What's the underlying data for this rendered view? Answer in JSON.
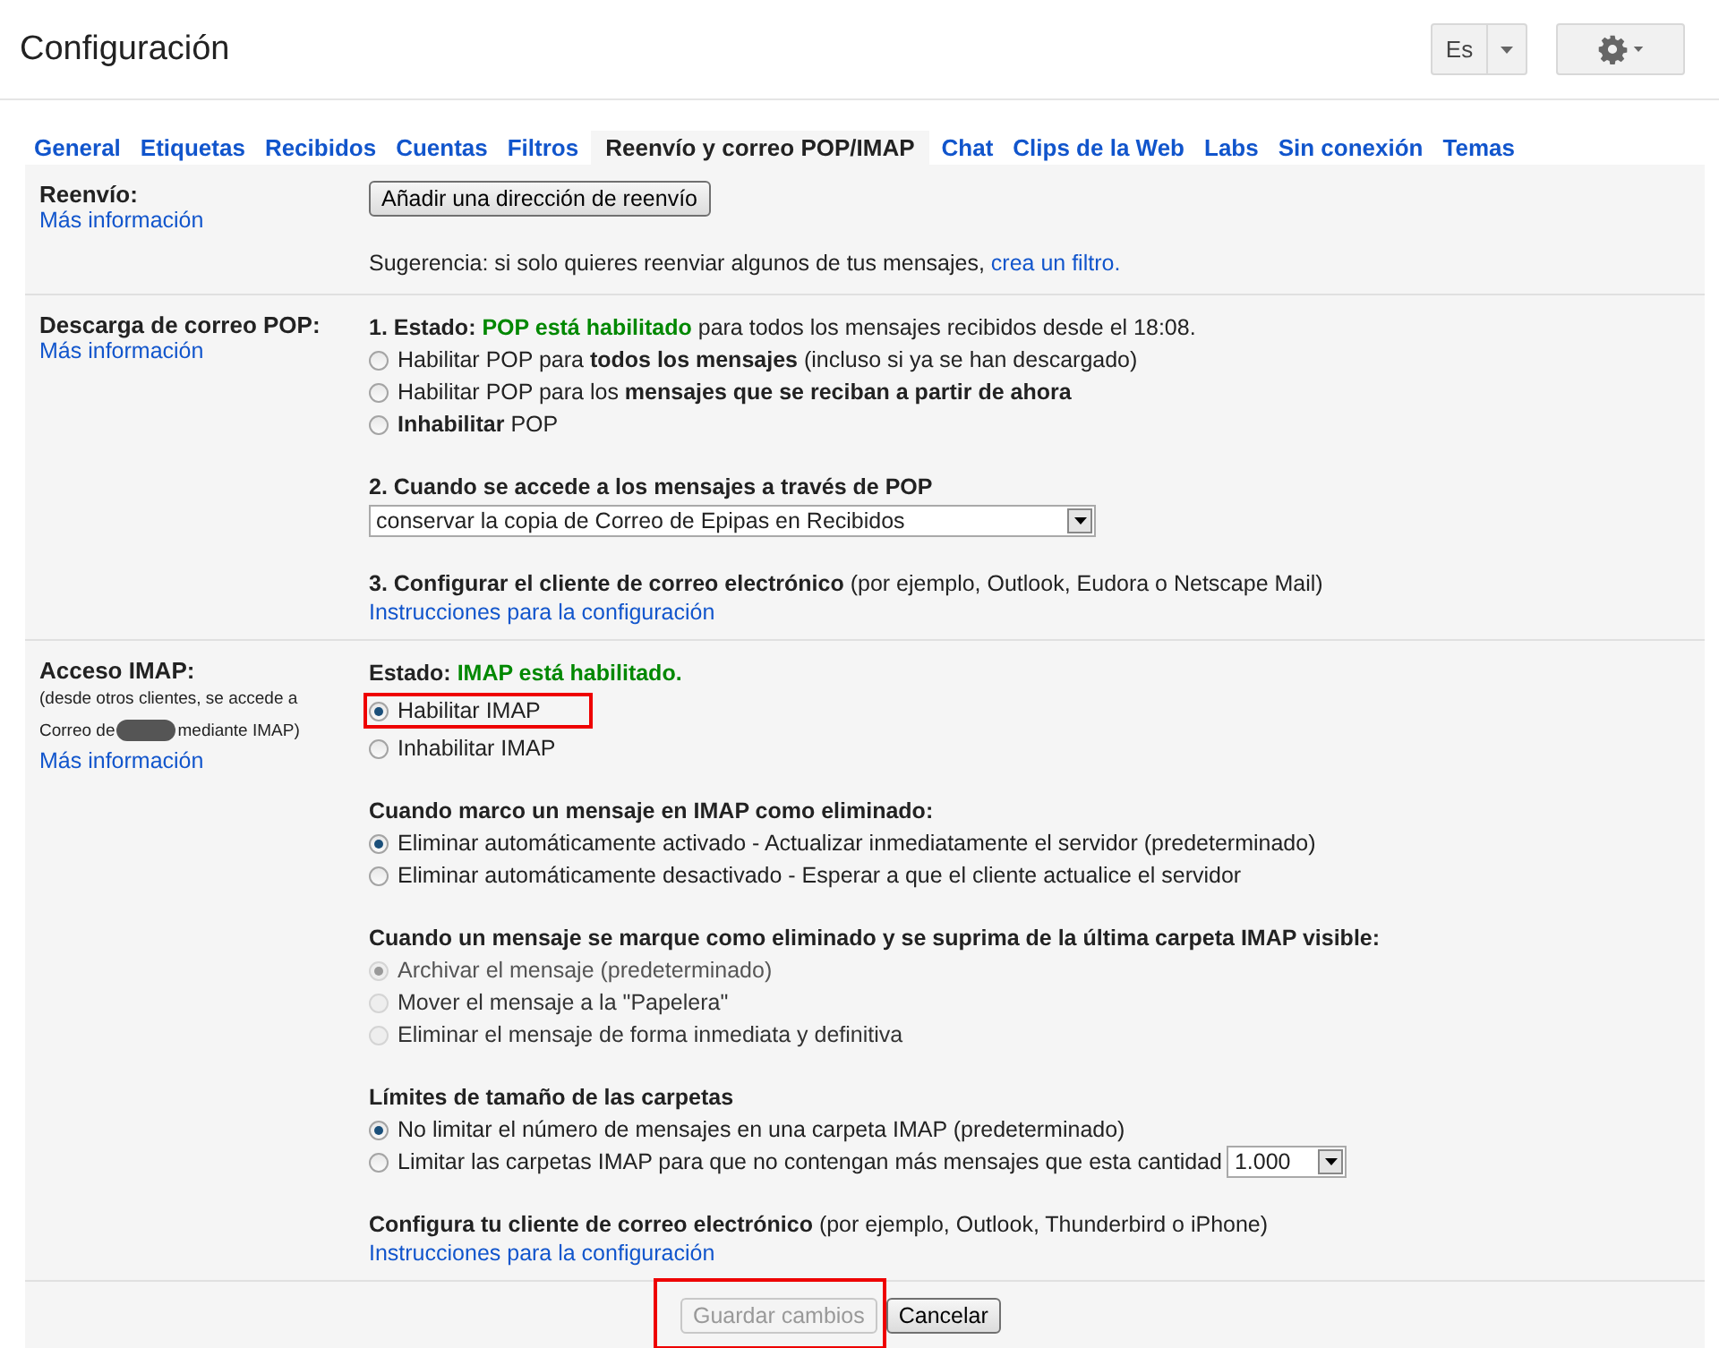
{
  "header": {
    "title": "Configuración",
    "language": "Es"
  },
  "tabs": [
    {
      "label": "General",
      "selected": false
    },
    {
      "label": "Etiquetas",
      "selected": false
    },
    {
      "label": "Recibidos",
      "selected": false
    },
    {
      "label": "Cuentas",
      "selected": false
    },
    {
      "label": "Filtros",
      "selected": false
    },
    {
      "label": "Reenvío y correo POP/IMAP",
      "selected": true
    },
    {
      "label": "Chat",
      "selected": false
    },
    {
      "label": "Clips de la Web",
      "selected": false
    },
    {
      "label": "Labs",
      "selected": false
    },
    {
      "label": "Sin conexión",
      "selected": false
    },
    {
      "label": "Temas",
      "selected": false
    }
  ],
  "sections": [
    {
      "label": "Reenvío:",
      "link": "Más información",
      "groups": [
        [
          {
            "kind": "button",
            "label": "Añadir una dirección de reenvío",
            "disabled": false,
            "highlighted": false
          }
        ],
        [
          {
            "kind": "hint",
            "text": "Sugerencia: si solo quieres reenviar algunos de tus mensajes,",
            "link": "crea un filtro."
          }
        ]
      ]
    },
    {
      "label": "Descarga de correo POP:",
      "link": "Más información",
      "groups": [
        [
          {
            "kind": "status",
            "head": "1. Estado:",
            "value": "POP está habilitado",
            "rest": "para todos los mensajes recibidos desde el 18:08."
          },
          {
            "kind": "radio",
            "label": "Habilitar POP para **todos los mensajes** (incluso si ya se han descargado)",
            "selected": false,
            "disabled": false,
            "highlighted": false
          },
          {
            "kind": "radio",
            "label": "Habilitar POP para los **mensajes que se reciban a partir de ahora**",
            "selected": false,
            "disabled": false,
            "highlighted": false
          },
          {
            "kind": "radio",
            "label": "**Inhabilitar** POP",
            "selected": false,
            "disabled": false,
            "highlighted": false
          }
        ],
        [
          {
            "kind": "heading",
            "text": "2. Cuando se accede a los mensajes a través de POP"
          },
          {
            "kind": "select",
            "value": "conservar la copia de Correo de Epipas en Recibidos"
          }
        ],
        [
          {
            "kind": "heading",
            "text": "3. Configurar el cliente de correo electrónico",
            "rest": "(por ejemplo, Outlook, Eudora o Netscape Mail)"
          },
          {
            "kind": "link",
            "text": "Instrucciones para la configuración"
          }
        ]
      ]
    },
    {
      "label": "Acceso IMAP:",
      "note": {
        "line": "(desde otros clientes, se accede a",
        "before": "Correo de",
        "after": "mediante IMAP)",
        "redacted": true
      },
      "link": "Más información",
      "groups": [
        [
          {
            "kind": "status",
            "head": "Estado:",
            "value": "IMAP está habilitado."
          },
          {
            "kind": "radio",
            "label": "Habilitar IMAP",
            "selected": true,
            "disabled": false,
            "highlighted": true
          },
          {
            "kind": "radio",
            "label": "Inhabilitar IMAP",
            "selected": false,
            "disabled": false,
            "highlighted": false
          }
        ],
        [
          {
            "kind": "heading",
            "text": "Cuando marco un mensaje en IMAP como eliminado:"
          },
          {
            "kind": "radio",
            "label": "Eliminar automáticamente activado - Actualizar inmediatamente el servidor (predeterminado)",
            "selected": true,
            "disabled": false,
            "highlighted": false
          },
          {
            "kind": "radio",
            "label": "Eliminar automáticamente desactivado - Esperar a que el cliente actualice el servidor",
            "selected": false,
            "disabled": false,
            "highlighted": false
          }
        ],
        [
          {
            "kind": "heading",
            "text": "Cuando un mensaje se marque como eliminado y se suprima de la última carpeta IMAP visible:"
          },
          {
            "kind": "radio",
            "label": "Archivar el mensaje (predeterminado)",
            "selected": true,
            "disabled": true,
            "highlighted": false
          },
          {
            "kind": "radio",
            "label": "Mover el mensaje a la \"Papelera\"",
            "selected": false,
            "disabled": true,
            "highlighted": false
          },
          {
            "kind": "radio",
            "label": "Eliminar el mensaje de forma inmediata y definitiva",
            "selected": false,
            "disabled": true,
            "highlighted": false
          }
        ],
        [
          {
            "kind": "heading",
            "text": "Límites de tamaño de las carpetas"
          },
          {
            "kind": "radio",
            "label": "No limitar el número de mensajes en una carpeta IMAP (predeterminado)",
            "selected": true,
            "disabled": false,
            "highlighted": false
          },
          {
            "kind": "radio",
            "label": "Limitar las carpetas IMAP para que no contengan más mensajes que esta cantidad",
            "select": "1.000",
            "selected": false,
            "disabled": false,
            "highlighted": false
          }
        ],
        [
          {
            "kind": "heading",
            "text": "Configura tu cliente de correo electrónico",
            "rest": "(por ejemplo, Outlook, Thunderbird o iPhone)"
          },
          {
            "kind": "link",
            "text": "Instrucciones para la configuración"
          }
        ]
      ]
    }
  ],
  "footer": [
    {
      "label": "Guardar cambios",
      "disabled": true,
      "highlighted": true
    },
    {
      "label": "Cancelar",
      "disabled": false,
      "highlighted": false
    }
  ]
}
